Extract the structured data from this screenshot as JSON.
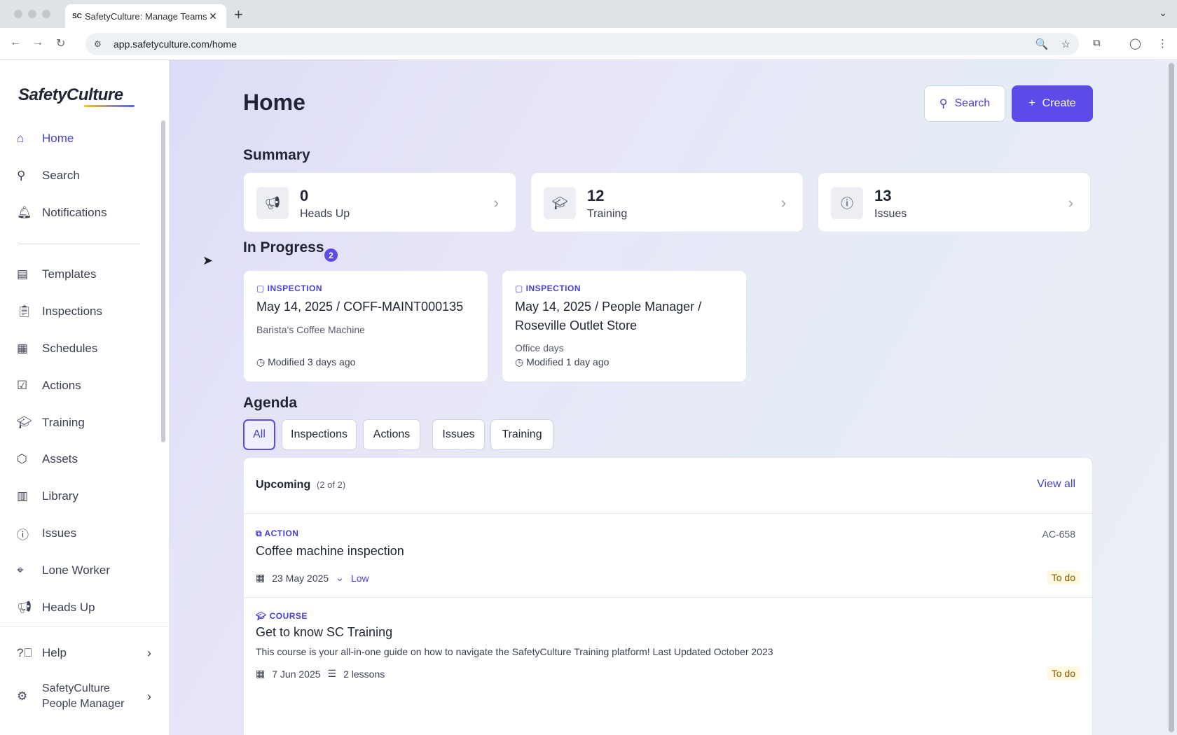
{
  "browser": {
    "tab_title": "SafetyCulture: Manage Teams",
    "url": "app.safetyculture.com/home"
  },
  "sidebar": {
    "logo": "SafetyCulture",
    "items": [
      {
        "label": "Home",
        "icon": "home-icon"
      },
      {
        "label": "Search",
        "icon": "search-icon"
      },
      {
        "label": "Notifications",
        "icon": "bell-icon"
      },
      {
        "label": "Templates",
        "icon": "templates-icon"
      },
      {
        "label": "Inspections",
        "icon": "clipboard-icon"
      },
      {
        "label": "Schedules",
        "icon": "calendar-icon"
      },
      {
        "label": "Actions",
        "icon": "actions-icon"
      },
      {
        "label": "Training",
        "icon": "graduation-cap-icon"
      },
      {
        "label": "Assets",
        "icon": "cube-icon"
      },
      {
        "label": "Library",
        "icon": "books-icon"
      },
      {
        "label": "Issues",
        "icon": "alert-icon"
      },
      {
        "label": "Lone Worker",
        "icon": "map-pin-icon"
      },
      {
        "label": "Heads Up",
        "icon": "megaphone-icon"
      }
    ],
    "help": "Help",
    "org_line1": "SafetyCulture",
    "org_line2": "People Manager"
  },
  "main": {
    "title": "Home",
    "search_label": "Search",
    "create_label": "Create",
    "summary": {
      "title": "Summary",
      "cards": [
        {
          "value": "0",
          "label": "Heads Up"
        },
        {
          "value": "12",
          "label": "Training"
        },
        {
          "value": "13",
          "label": "Issues"
        }
      ]
    },
    "in_progress": {
      "title": "In Progress",
      "count": "2",
      "cards": [
        {
          "type": "INSPECTION",
          "title": "May 14, 2025 / COFF-MAINT000135",
          "subtitle": "Barista's Coffee Machine",
          "modified": "Modified 3 days ago"
        },
        {
          "type": "INSPECTION",
          "title": "May 14, 2025 / People Manager / Roseville Outlet Store",
          "subtitle": "Office days",
          "modified": "Modified 1 day ago"
        }
      ]
    },
    "agenda": {
      "title": "Agenda",
      "filters": [
        "All",
        "Inspections",
        "Actions",
        "Issues",
        "Training"
      ],
      "upcoming_label": "Upcoming",
      "upcoming_count": "(2 of 2)",
      "view_all": "View all",
      "rows": [
        {
          "type": "ACTION",
          "title": "Coffee machine inspection",
          "id": "AC-658",
          "date": "23 May 2025",
          "priority": "Low",
          "status": "To do"
        },
        {
          "type": "COURSE",
          "title": "Get to know SC Training",
          "description": "This course is your all-in-one guide on how to navigate the SafetyCulture Training platform! Last Updated October 2023",
          "date": "7 Jun 2025",
          "lessons": "2 lessons",
          "status": "To do"
        }
      ]
    }
  }
}
